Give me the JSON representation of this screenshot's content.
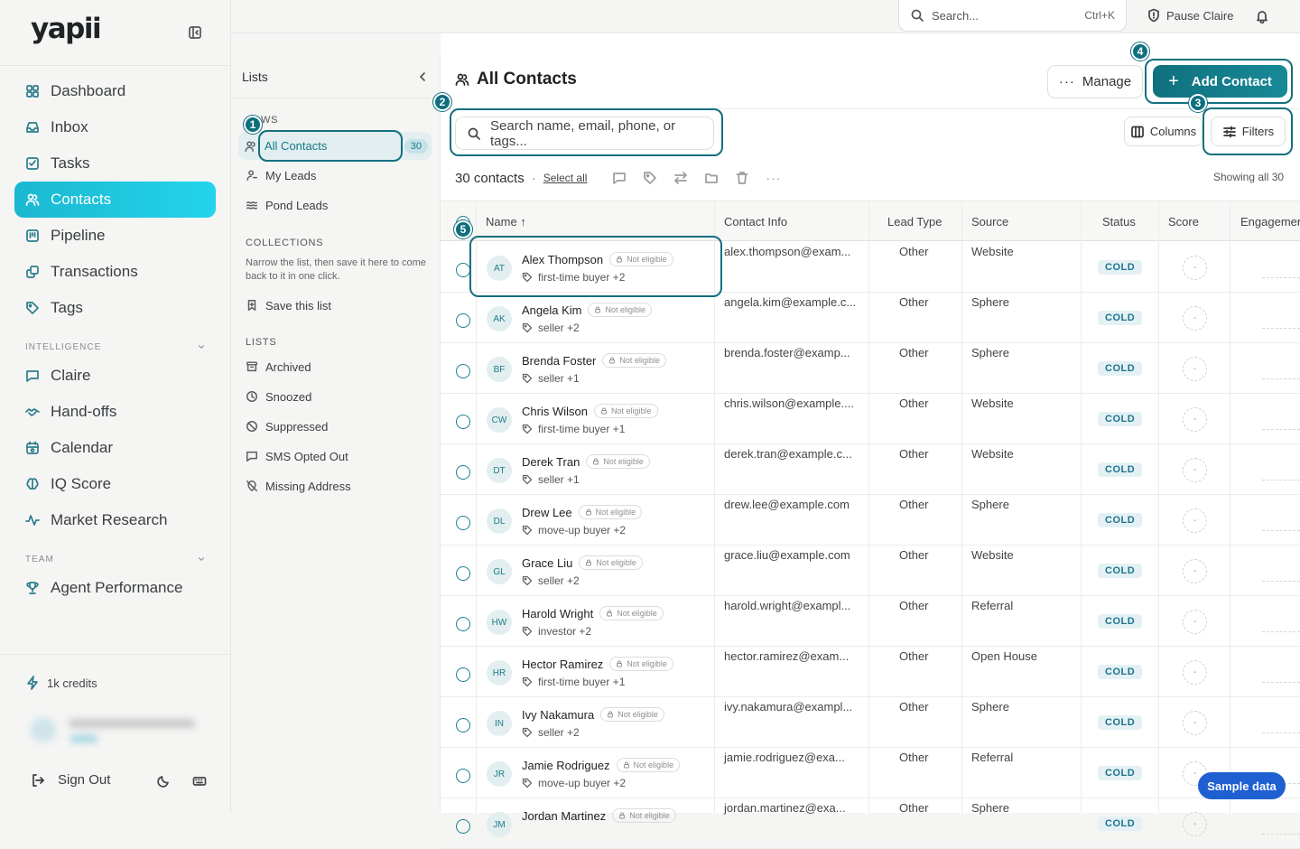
{
  "app": {
    "logo": "yapii"
  },
  "sidebar": {
    "nav": [
      {
        "label": "Dashboard",
        "icon": "grid-icon"
      },
      {
        "label": "Inbox",
        "icon": "inbox-icon"
      },
      {
        "label": "Tasks",
        "icon": "checkbox-icon"
      },
      {
        "label": "Contacts",
        "icon": "users-icon",
        "active": true
      },
      {
        "label": "Pipeline",
        "icon": "pipeline-icon"
      },
      {
        "label": "Transactions",
        "icon": "transactions-icon"
      },
      {
        "label": "Tags",
        "icon": "tag-icon"
      }
    ],
    "intelligence_heading": "INTELLIGENCE",
    "intelligence": [
      {
        "label": "Claire",
        "icon": "chat-icon"
      },
      {
        "label": "Hand-offs",
        "icon": "handshake-icon"
      },
      {
        "label": "Calendar",
        "icon": "calendar-icon"
      },
      {
        "label": "IQ Score",
        "icon": "brain-icon"
      },
      {
        "label": "Market Research",
        "icon": "activity-icon"
      }
    ],
    "team_heading": "TEAM",
    "team": [
      {
        "label": "Agent Performance",
        "icon": "trophy-icon"
      }
    ],
    "credits": "1k credits",
    "sign_out": "Sign Out"
  },
  "topbar": {
    "search_placeholder": "Search...",
    "search_shortcut": "Ctrl+K",
    "pause_label": "Pause Claire"
  },
  "lists_panel": {
    "title": "Lists",
    "views_heading": "WS",
    "views": [
      {
        "label": "All Contacts",
        "count": "30",
        "active": true
      },
      {
        "label": "My Leads"
      },
      {
        "label": "Pond Leads"
      }
    ],
    "collections_heading": "COLLECTIONS",
    "collections_desc": "Narrow the list, then save it here to come back to it in one click.",
    "save_list": "Save this list",
    "lists_heading": "LISTS",
    "lists": [
      "Archived",
      "Snoozed",
      "Suppressed",
      "SMS Opted Out",
      "Missing Address"
    ]
  },
  "main": {
    "title": "All Contacts",
    "manage_label": "Manage",
    "add_label": "Add Contact",
    "search_placeholder": "Search name, email, phone, or tags...",
    "columns_label": "Columns",
    "filters_label": "Filters",
    "count_label": "30 contacts",
    "select_all": "Select all",
    "showing": "Showing all 30",
    "headers": [
      "Name",
      "Contact Info",
      "Lead Type",
      "Source",
      "Status",
      "Score",
      "Engagement"
    ],
    "sort_indicator": "↑"
  },
  "contacts": [
    {
      "initials": "AT",
      "name": "Alex Thompson",
      "eligibility": "Not eligible",
      "tags": "first-time buyer +2",
      "email": "alex.thompson@exam...",
      "lead_type": "Other",
      "source": "Website",
      "status": "COLD",
      "score": "-"
    },
    {
      "initials": "AK",
      "name": "Angela Kim",
      "eligibility": "Not eligible",
      "tags": "seller +2",
      "email": "angela.kim@example.c...",
      "lead_type": "Other",
      "source": "Sphere",
      "status": "COLD",
      "score": "-"
    },
    {
      "initials": "BF",
      "name": "Brenda Foster",
      "eligibility": "Not eligible",
      "tags": "seller +1",
      "email": "brenda.foster@examp...",
      "lead_type": "Other",
      "source": "Sphere",
      "status": "COLD",
      "score": "-"
    },
    {
      "initials": "CW",
      "name": "Chris Wilson",
      "eligibility": "Not eligible",
      "tags": "first-time buyer +1",
      "email": "chris.wilson@example....",
      "lead_type": "Other",
      "source": "Website",
      "status": "COLD",
      "score": "-"
    },
    {
      "initials": "DT",
      "name": "Derek Tran",
      "eligibility": "Not eligible",
      "tags": "seller +1",
      "email": "derek.tran@example.c...",
      "lead_type": "Other",
      "source": "Website",
      "status": "COLD",
      "score": "-"
    },
    {
      "initials": "DL",
      "name": "Drew Lee",
      "eligibility": "Not eligible",
      "tags": "move-up buyer +2",
      "email": "drew.lee@example.com",
      "lead_type": "Other",
      "source": "Sphere",
      "status": "COLD",
      "score": "-"
    },
    {
      "initials": "GL",
      "name": "Grace Liu",
      "eligibility": "Not eligible",
      "tags": "seller +2",
      "email": "grace.liu@example.com",
      "lead_type": "Other",
      "source": "Website",
      "status": "COLD",
      "score": "-"
    },
    {
      "initials": "HW",
      "name": "Harold Wright",
      "eligibility": "Not eligible",
      "tags": "investor +2",
      "email": "harold.wright@exampl...",
      "lead_type": "Other",
      "source": "Referral",
      "status": "COLD",
      "score": "-"
    },
    {
      "initials": "HR",
      "name": "Hector Ramirez",
      "eligibility": "Not eligible",
      "tags": "first-time buyer +1",
      "email": "hector.ramirez@exam...",
      "lead_type": "Other",
      "source": "Open House",
      "status": "COLD",
      "score": "-"
    },
    {
      "initials": "IN",
      "name": "Ivy Nakamura",
      "eligibility": "Not eligible",
      "tags": "seller +2",
      "email": "ivy.nakamura@exampl...",
      "lead_type": "Other",
      "source": "Sphere",
      "status": "COLD",
      "score": "-"
    },
    {
      "initials": "JR",
      "name": "Jamie Rodriguez",
      "eligibility": "Not eligible",
      "tags": "move-up buyer +2",
      "email": "jamie.rodriguez@exa...",
      "lead_type": "Other",
      "source": "Referral",
      "status": "COLD",
      "score": "-"
    },
    {
      "initials": "JM",
      "name": "Jordan Martinez",
      "eligibility": "Not eligible",
      "tags": "",
      "email": "jordan.martinez@exa...",
      "lead_type": "Other",
      "source": "Sphere",
      "status": "COLD",
      "score": "-"
    }
  ],
  "tour": {
    "badges": [
      "1",
      "2",
      "3",
      "4",
      "5"
    ]
  },
  "sample_data_label": "Sample data",
  "colors": {
    "accent": "#137a8a",
    "active_nav": "#1bb8d0",
    "cold_badge": "#1d7390",
    "sample_button": "#1e5fd2"
  }
}
